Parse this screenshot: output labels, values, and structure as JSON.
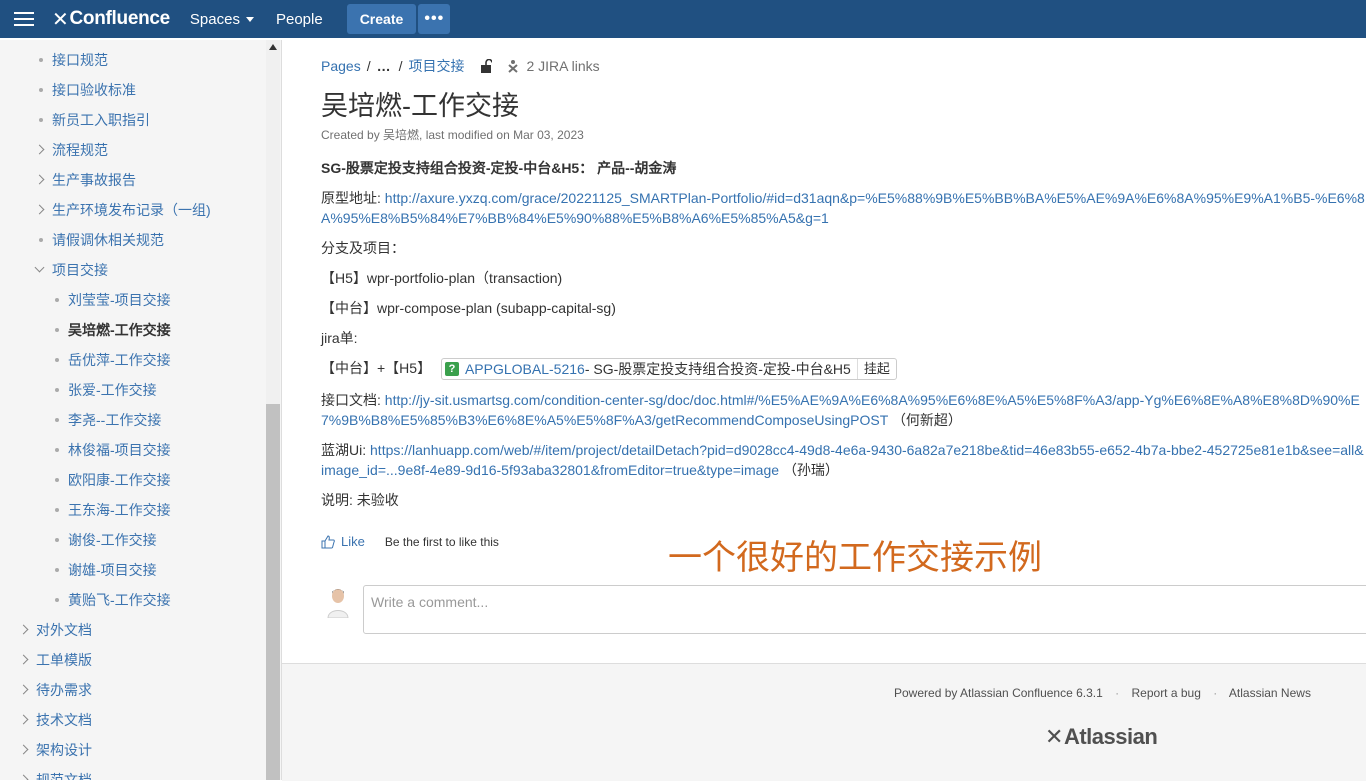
{
  "header": {
    "logo_text": "Confluence",
    "nav": {
      "spaces": "Spaces",
      "people": "People"
    },
    "create": "Create",
    "more": "•••"
  },
  "sidebar": {
    "items": [
      {
        "label": "接口规范",
        "type": "bullet",
        "level": 1
      },
      {
        "label": "接口验收标准",
        "type": "bullet",
        "level": 1
      },
      {
        "label": "新员工入职指引",
        "type": "bullet",
        "level": 1
      },
      {
        "label": "流程规范",
        "type": "collapsed",
        "level": 1
      },
      {
        "label": "生产事故报告",
        "type": "collapsed",
        "level": 1
      },
      {
        "label": "生产环境发布记录（一组)",
        "type": "collapsed",
        "level": 1
      },
      {
        "label": "请假调休相关规范",
        "type": "bullet",
        "level": 1
      },
      {
        "label": "项目交接",
        "type": "expanded",
        "level": 1
      },
      {
        "label": "刘莹莹-项目交接",
        "type": "bullet",
        "level": 2
      },
      {
        "label": "吴培燃-工作交接",
        "type": "bullet",
        "level": 2,
        "current": true
      },
      {
        "label": "岳优萍-工作交接",
        "type": "bullet",
        "level": 2
      },
      {
        "label": "张爱-工作交接",
        "type": "bullet",
        "level": 2
      },
      {
        "label": "李尧--工作交接",
        "type": "bullet",
        "level": 2
      },
      {
        "label": "林俊福-项目交接",
        "type": "bullet",
        "level": 2
      },
      {
        "label": "欧阳康-工作交接",
        "type": "bullet",
        "level": 2
      },
      {
        "label": "王东海-工作交接",
        "type": "bullet",
        "level": 2
      },
      {
        "label": "谢俊-工作交接",
        "type": "bullet",
        "level": 2
      },
      {
        "label": "谢雄-项目交接",
        "type": "bullet",
        "level": 2
      },
      {
        "label": "黄贻飞-工作交接",
        "type": "bullet",
        "level": 2
      },
      {
        "label": "对外文档",
        "type": "collapsed",
        "level": 0
      },
      {
        "label": "工单模版",
        "type": "collapsed",
        "level": 0
      },
      {
        "label": "待办需求",
        "type": "collapsed",
        "level": 0
      },
      {
        "label": "技术文档",
        "type": "collapsed",
        "level": 0
      },
      {
        "label": "架构设计",
        "type": "collapsed",
        "level": 0
      },
      {
        "label": "规范文档",
        "type": "collapsed",
        "level": 0
      }
    ]
  },
  "page": {
    "breadcrumb": {
      "pages": "Pages",
      "ellipsis": "…",
      "parent": "项目交接",
      "separator": "/"
    },
    "jira_links": "2 JIRA links",
    "title": "吴培燃-工作交接",
    "byline": "Created by 吴培燃, last modified on Mar 03, 2023"
  },
  "content": {
    "heading": "SG-股票定投支持组合投资-定投-中台&H5：  产品--胡金涛",
    "prototype_label": "原型地址:",
    "prototype_url": "http://axure.yxzq.com/grace/20221125_SMARTPlan-Portfolio/#id=d31aqn&p=%E5%88%9B%E5%BB%BA%E5%AE%9A%E6%8A%95%E9%A1%B5-%E6%8A%95%E8%B5%84%E7%BB%84%E5%90%88%E5%B8%A6%E5%85%A5&g=1",
    "branch_label": "分支及项目：",
    "branch_h5": "【H5】wpr-portfolio-plan（transaction)",
    "branch_middle": "【中台】wpr-compose-plan (subapp-capital-sg)",
    "jira_label": "jira单:",
    "jira_prefix": "【中台】+【H5】",
    "jira_key": "APPGLOBAL-5216",
    "jira_summary": " - SG-股票定投支持组合投资-定投-中台&H5",
    "jira_status": "挂起",
    "api_label": "接口文档:",
    "api_url": "http://jy-sit.usmartsg.com/condition-center-sg/doc/doc.html#/%E5%AE%9A%E6%8A%95%E6%8E%A5%E5%8F%A3/app-Yg%E6%8E%A8%E8%8D%90%E7%9B%B8%E5%85%B3%E6%8E%A5%E5%8F%A3/getRecommendComposeUsingPOST",
    "api_owner": "（何新超）",
    "lanhu_label": "蓝湖Ui:",
    "lanhu_url": "https://lanhuapp.com/web/#/item/project/detailDetach?pid=d9028cc4-49d8-4e6a-9430-6a82a7e218be&tid=46e83b55-e652-4b7a-bbe2-452725e81e1b&see=all&image_id=...9e8f-4e89-9d16-5f93aba32801&fromEditor=true&type=image",
    "lanhu_owner": "（孙瑞）",
    "note": "说明: 未验收"
  },
  "like": {
    "label": "Like",
    "info": "Be the first to like this"
  },
  "annotation": "一个很好的工作交接示例",
  "comment": {
    "placeholder": "Write a comment..."
  },
  "footer": {
    "powered": "Powered by Atlassian Confluence 6.3.1",
    "report": "Report a bug",
    "news": "Atlassian News",
    "logo": "Atlassian"
  },
  "colors": {
    "header_bg": "#205081",
    "link": "#3572b0",
    "annotation": "#d2691e"
  }
}
